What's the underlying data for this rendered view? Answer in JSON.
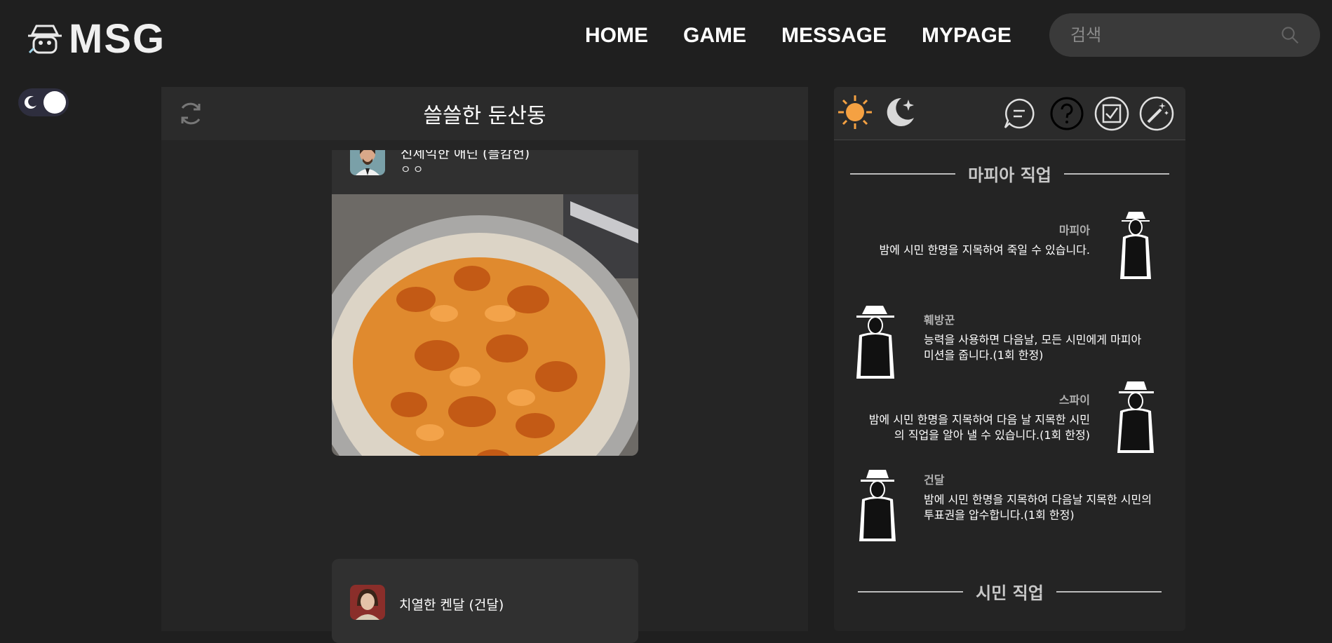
{
  "brand": {
    "name": "MSG"
  },
  "nav": {
    "items": [
      "HOME",
      "GAME",
      "MESSAGE",
      "MYPAGE"
    ]
  },
  "search": {
    "placeholder": "검색"
  },
  "feed": {
    "title": "쓸쓸한 둔산동",
    "posts": [
      {
        "author": "신세익한 애딘 (플캄헌)",
        "text": "ㅇㅇ"
      },
      {
        "author": "치열한 켄달 (건달)"
      }
    ]
  },
  "panel": {
    "mafia_section": "마피아 직업",
    "citizen_section": "시민 직업",
    "roles": [
      {
        "name": "마피아",
        "desc": "밤에 시민 한명을 지목하여 죽일 수 있습니다."
      },
      {
        "name": "훼방꾼",
        "desc_lines": [
          "능력을 사용하면 다음날, 모든 시민에게 마피아",
          "미션을 줍니다.(1회 한정)"
        ]
      },
      {
        "name": "스파이",
        "desc_lines": [
          "밤에 시민 한명을 지목하여 다음 날 지목한 시민",
          "의 직업을 알아 낼 수 있습니다.(1회 한정)"
        ]
      },
      {
        "name": "건달",
        "desc_lines": [
          "밤에 시민 한명을 지목하여 다음날 지목한 시민의",
          "투표권을 압수합니다.(1회 한정)"
        ]
      }
    ]
  },
  "colors": {
    "sun": "#f5a142",
    "background": "#1f1f1f",
    "panel": "#242424"
  }
}
